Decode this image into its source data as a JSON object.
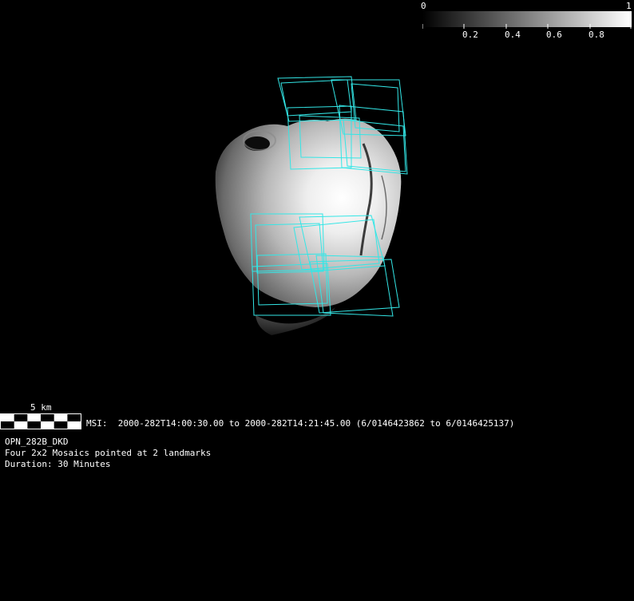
{
  "colorbar": {
    "min_label": "0",
    "max_label": "1",
    "tick_labels": [
      "0.2",
      "0.4",
      "0.6",
      "0.8"
    ]
  },
  "scale_bar": {
    "label": "5 km"
  },
  "observation": {
    "time_range": "MSI:  2000-282T14:00:30.00 to 2000-282T14:21:45.00 (6/0146423862 to 6/0146425137)",
    "id": "OPN_282B_DKD",
    "description": "Four 2x2 Mosaics pointed at 2 landmarks",
    "duration": "Duration: 30 Minutes"
  },
  "colors": {
    "footprint": "#33e6e6",
    "background": "#000000"
  }
}
